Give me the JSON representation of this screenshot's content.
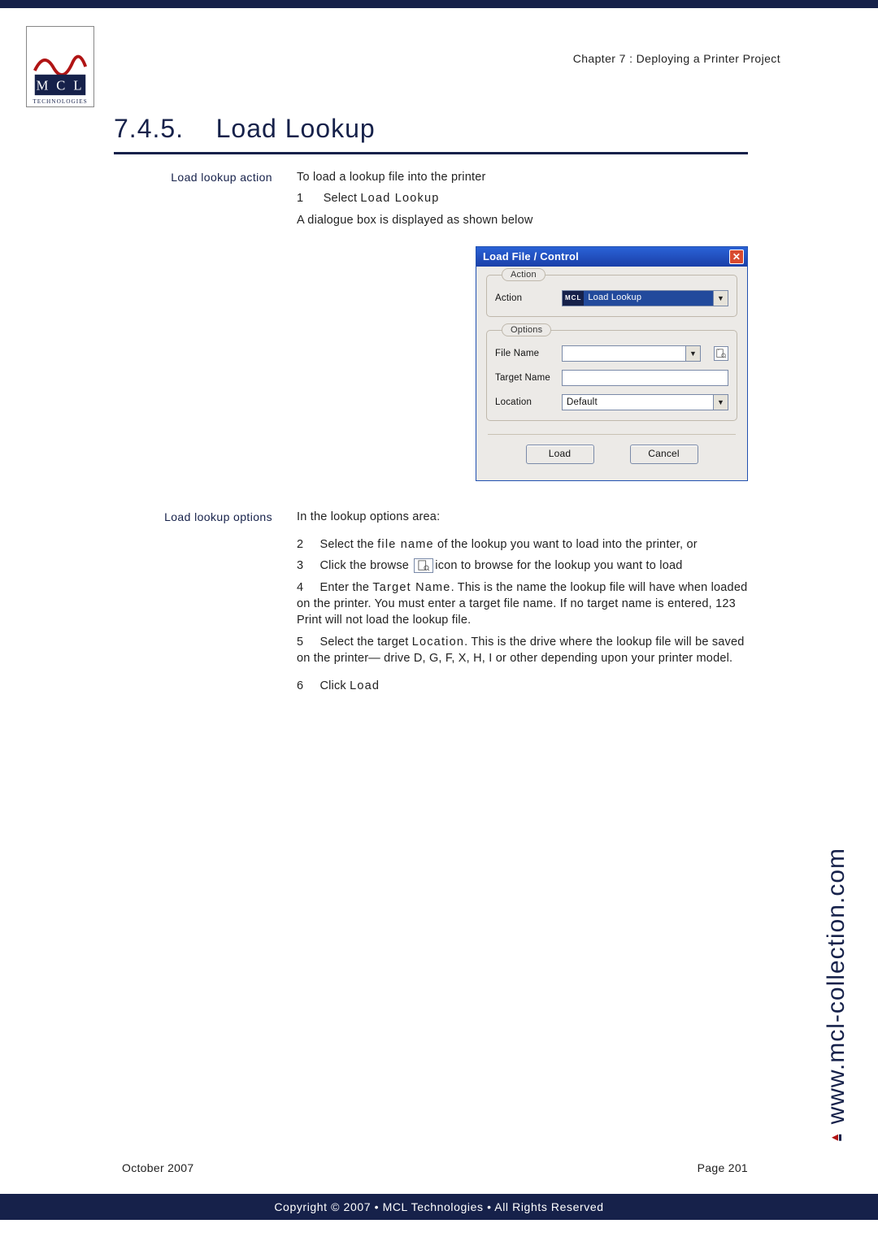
{
  "header": {
    "chapter_line": "Chapter 7 : Deploying a Printer Project",
    "section_number": "7.4.5.",
    "section_title": "Load Lookup"
  },
  "logo": {
    "line1": "M C L",
    "line2": "TECHNOLOGIES"
  },
  "sections": {
    "action": {
      "side_label": "Load lookup action",
      "intro": "To load a lookup file into the printer",
      "step1_num": "1",
      "step1_pre": "Select ",
      "step1_bold": "Load Lookup",
      "post_note": "A dialogue box is displayed as shown below"
    },
    "options": {
      "side_label": "Load lookup options",
      "intro": "In the lookup options area:",
      "items": {
        "i2": {
          "num": "2",
          "pre": "Select the ",
          "bold": "file name",
          "post": " of the lookup you want to load into the printer, or"
        },
        "i3": {
          "num": "3",
          "pre": "Click the browse ",
          "post": "icon to browse for the lookup you want to load"
        },
        "i4": {
          "num": "4",
          "pre": "Enter the ",
          "bold": "Target Name",
          "post": ". This is the name the lookup file will have when loaded on the printer. You must enter a target file name. If no target name is entered, 123 Print will not load the lookup file."
        },
        "i5": {
          "num": "5",
          "pre": "Select the target ",
          "bold": "Location",
          "post": ". This is the drive where the lookup file will be saved on the printer— drive D, G, F, X, H, I or other depending upon your printer model."
        },
        "i6": {
          "num": "6",
          "pre": "Click ",
          "bold": "Load"
        }
      }
    }
  },
  "dialog": {
    "title": "Load File / Control",
    "group_action": "Action",
    "label_action": "Action",
    "action_prefix": "MCL",
    "action_value": "Load Lookup",
    "group_options": "Options",
    "label_filename": "File Name",
    "label_targetname": "Target Name",
    "label_location": "Location",
    "location_value": "Default",
    "btn_load": "Load",
    "btn_cancel": "Cancel"
  },
  "side_url": "www.mcl-collection.com",
  "footer": {
    "date": "October 2007",
    "page": "Page 201",
    "copyright": "Copyright © 2007 • MCL Technologies • All Rights Reserved"
  }
}
